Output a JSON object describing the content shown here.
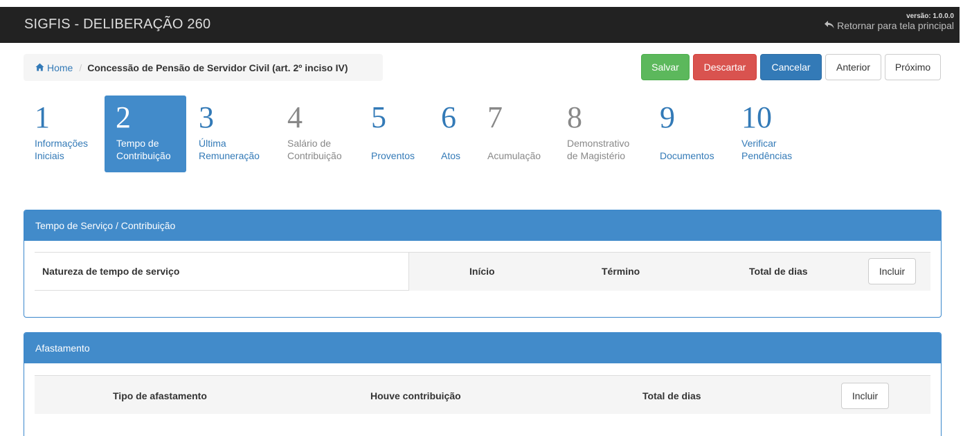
{
  "header": {
    "app_title": "SIGFIS - DELIBERAÇÃO 260",
    "version": "versão: 1.0.0.0",
    "back_link": "Retornar para tela principal"
  },
  "breadcrumb": {
    "home": "Home",
    "separator": "/",
    "current": "Concessão de Pensão de Servidor Civil (art. 2º inciso IV)"
  },
  "actions": {
    "save": "Salvar",
    "discard": "Descartar",
    "cancel": "Cancelar",
    "previous": "Anterior",
    "next": "Próximo"
  },
  "steps": [
    {
      "number": "1",
      "line1": "Informações",
      "line2": "Iniciais",
      "state": "link"
    },
    {
      "number": "2",
      "line1": "Tempo de",
      "line2": "Contribuição",
      "state": "active"
    },
    {
      "number": "3",
      "line1": "Última",
      "line2": "Remuneração",
      "state": "link"
    },
    {
      "number": "4",
      "line1": "Salário de",
      "line2": "Contribuição",
      "state": "muted"
    },
    {
      "number": "5",
      "line1": "",
      "line2": "Proventos",
      "state": "link"
    },
    {
      "number": "6",
      "line1": "",
      "line2": "Atos",
      "state": "link"
    },
    {
      "number": "7",
      "line1": "",
      "line2": "Acumulação",
      "state": "muted"
    },
    {
      "number": "8",
      "line1": "Demonstrativo",
      "line2": "de Magistério",
      "state": "muted"
    },
    {
      "number": "9",
      "line1": "",
      "line2": "Documentos",
      "state": "link"
    },
    {
      "number": "10",
      "line1": "Verificar",
      "line2": "Pendências",
      "state": "link"
    }
  ],
  "panel_service": {
    "title": "Tempo de Serviço / Contribuição",
    "columns": [
      "Natureza de tempo de serviço",
      "Início",
      "Término",
      "Total de dias"
    ],
    "include": "Incluir"
  },
  "panel_leave": {
    "title": "Afastamento",
    "columns": [
      "Tipo de afastamento",
      "Houve contribuição",
      "Total de dias"
    ],
    "include": "Incluir"
  },
  "colors": {
    "topbar": "#222222",
    "primary": "#428bca",
    "success": "#5cb85c",
    "danger": "#d9534f",
    "link": "#337ab7",
    "muted": "#888888"
  },
  "icons": {
    "back": "reply-icon",
    "home": "home-icon"
  }
}
